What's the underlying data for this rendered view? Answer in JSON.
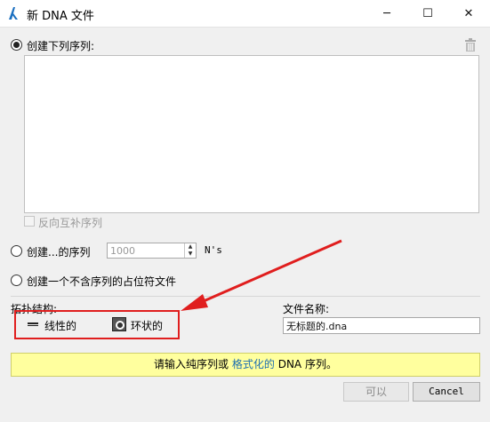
{
  "window": {
    "title": "新 DNA 文件",
    "min_glyph": "─",
    "max_glyph": "☐",
    "close_glyph": "✕"
  },
  "create_sequences": {
    "label": "创建下列序列:",
    "selected": true
  },
  "reverse_complement": {
    "label": "反向互补序列",
    "checked": false,
    "enabled": false
  },
  "create_n": {
    "prefix": "创建...的序列",
    "count": "1000",
    "unit": "N's",
    "selected": false
  },
  "placeholder_file": {
    "label": "创建一个不含序列的占位符文件",
    "selected": false
  },
  "topology": {
    "label": "拓扑结构:",
    "linear_label": "线性的",
    "circular_label": "环状的"
  },
  "file_name": {
    "label": "文件名称:",
    "value": "无标题的.dna"
  },
  "notice": {
    "text_before": "请输入纯序列或 ",
    "link": "格式化的",
    "text_after": " DNA 序列。"
  },
  "buttons": {
    "ok": "可以",
    "cancel": "Cancel"
  },
  "colors": {
    "highlight_box": "#e01e1e",
    "notice_bg": "#ffff9e",
    "link": "#1f6fb0"
  }
}
